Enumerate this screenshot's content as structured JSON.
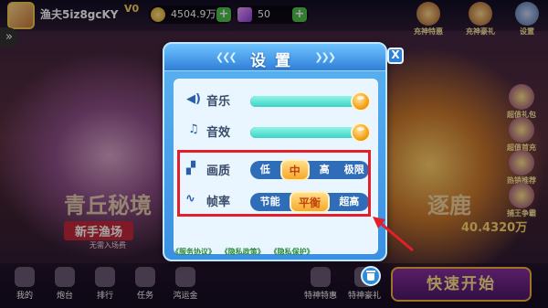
{
  "top": {
    "nickname": "渔夫5iz8gcKY",
    "vip": "V0",
    "gold": "4504.9万",
    "gems": "50",
    "plus": "+",
    "icons": [
      {
        "label": "充神特惠"
      },
      {
        "label": "充神豪礼"
      },
      {
        "label": "设置"
      }
    ]
  },
  "sidebar_right": [
    {
      "label": "超值礼包"
    },
    {
      "label": "超值首充"
    },
    {
      "label": "热销推荐"
    },
    {
      "label": "捕王争霸"
    }
  ],
  "modes": {
    "left_title": "青丘秘境",
    "left_tag": "新手渔场",
    "left_sub": "无需入场费",
    "right_title": "逐鹿",
    "right_number": "40.4320万"
  },
  "bottom_nav": [
    {
      "label": "我的"
    },
    {
      "label": "炮台"
    },
    {
      "label": "排行"
    },
    {
      "label": "任务"
    },
    {
      "label": "鸿运金"
    },
    {
      "label": "特神特惠"
    },
    {
      "label": "特神豪礼"
    }
  ],
  "quick_start": "快速开始",
  "settings": {
    "title": "设置",
    "close": "X",
    "music_label": "音乐",
    "music_level": 1.0,
    "sfx_label": "音效",
    "sfx_level": 1.0,
    "quality_label": "画质",
    "quality_options": [
      "低",
      "中",
      "高",
      "极限"
    ],
    "quality_selected": "中",
    "framerate_label": "帧率",
    "framerate_options": [
      "节能",
      "平衡",
      "超高"
    ],
    "framerate_selected": "平衡",
    "links": [
      "《服务协议》",
      "《隐私政策》",
      "《隐私保护》"
    ]
  },
  "colors": {
    "highlight": "#e3202a",
    "dialog_blue": "#3a8fe2",
    "slider_fill": "#3fd2c6",
    "active_option": "#f7a728"
  }
}
